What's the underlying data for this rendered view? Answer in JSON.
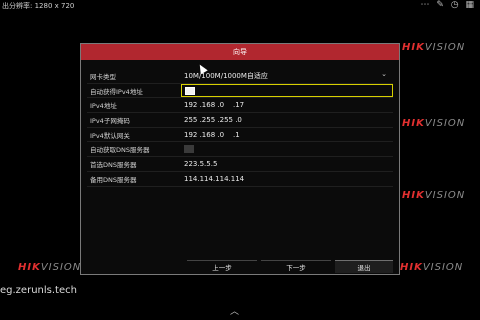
{
  "topbar": {
    "text": "出分辨率:   1280 x 720",
    "icons": "⋯ ✎ ◷ ▦"
  },
  "watermark": {
    "brand_red": "HIK",
    "brand_gray": "VISION"
  },
  "dialog": {
    "title": "向导",
    "rows": [
      {
        "label": "网卡类型",
        "value": "10M/100M/1000M自适应"
      },
      {
        "label": "自动获得IPv4地址",
        "value": ""
      },
      {
        "label": "IPv4地址",
        "value": "192 .168 .0    .17"
      },
      {
        "label": "IPv4子网掩码",
        "value": "255 .255 .255 .0"
      },
      {
        "label": "IPv4默认网关",
        "value": "192 .168 .0    .1"
      },
      {
        "label": "自动获取DNS服务器",
        "value": ""
      },
      {
        "label": "首选DNS服务器",
        "value": "223.5.5.5"
      },
      {
        "label": "备用DNS服务器",
        "value": "114.114.114.114"
      }
    ],
    "buttons": {
      "prev": "上一步",
      "next": "下一步",
      "exit": "退出"
    }
  },
  "url_text": "eg.zerunls.tech",
  "colors": {
    "title_bar": "#b1272f",
    "highlight_border": "#d8d000",
    "hik_red": "#e23030"
  }
}
